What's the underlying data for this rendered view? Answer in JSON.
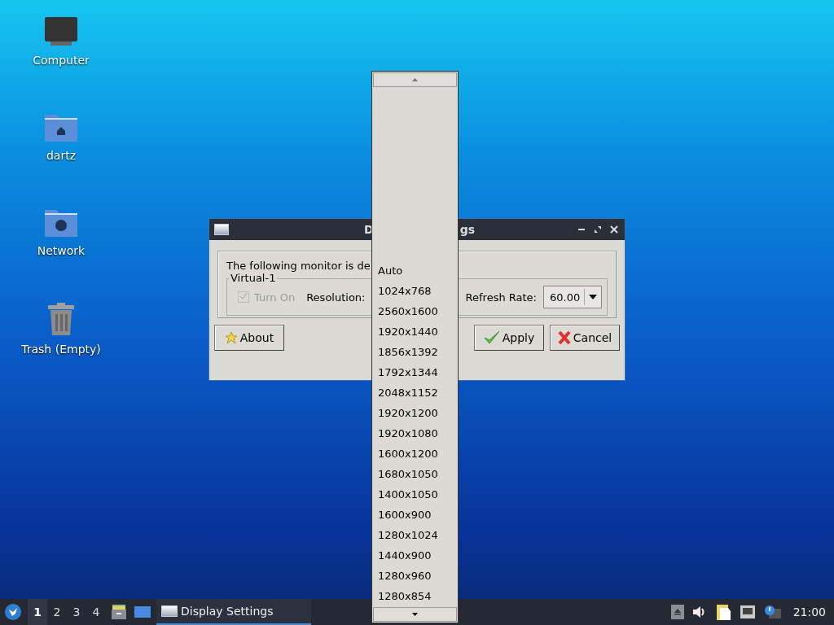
{
  "desktop_icons": [
    {
      "label": "Computer",
      "kind": "computer"
    },
    {
      "label": "dartz",
      "kind": "home"
    },
    {
      "label": "Network",
      "kind": "network"
    },
    {
      "label": "Trash (Empty)",
      "kind": "trash"
    }
  ],
  "dialog": {
    "title_start": "D",
    "title_end": "gs",
    "message": "The following monitor is de",
    "monitor": {
      "name": "Virtual-1",
      "turn_on": {
        "label": "Turn On",
        "checked": true,
        "disabled": true
      },
      "resolution_label": "Resolution:",
      "refresh_label": "Refresh Rate:",
      "refresh_value": "60.00"
    },
    "buttons": [
      {
        "label": "About",
        "kind": "about"
      },
      {
        "label": "Apply",
        "kind": "apply"
      },
      {
        "label": "Cancel",
        "kind": "cancel"
      }
    ]
  },
  "resolution_popup": {
    "items": [
      "Auto",
      "1024x768",
      "2560x1600",
      "1920x1440",
      "1856x1392",
      "1792x1344",
      "2048x1152",
      "1920x1200",
      "1920x1080",
      "1600x1200",
      "1680x1050",
      "1400x1050",
      "1600x900",
      "1280x1024",
      "1440x900",
      "1280x960",
      "1280x854"
    ]
  },
  "taskbar": {
    "workspaces": [
      {
        "label": "1",
        "selected": true
      },
      {
        "label": "2",
        "selected": false
      },
      {
        "label": "3",
        "selected": false
      },
      {
        "label": "4",
        "selected": false
      }
    ],
    "tasks": [
      {
        "label": "Display Settings",
        "selected": true
      }
    ],
    "clock": "21:00"
  }
}
